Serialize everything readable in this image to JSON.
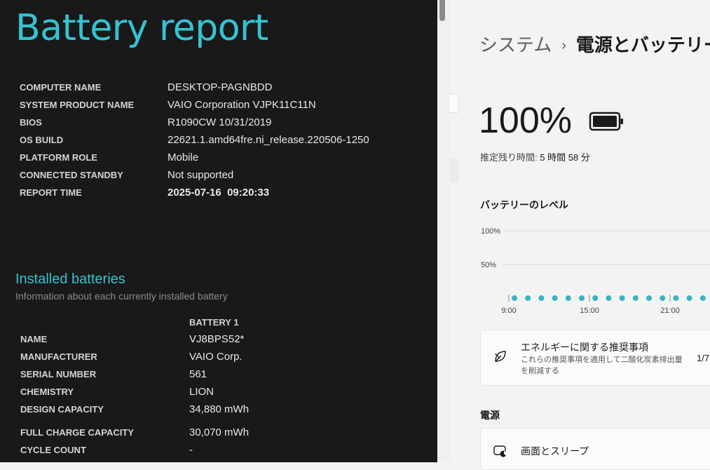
{
  "report": {
    "title": "Battery report",
    "system_info": [
      {
        "label": "COMPUTER NAME",
        "value": "DESKTOP-PAGNBDD"
      },
      {
        "label": "SYSTEM PRODUCT NAME",
        "value": "VAIO Corporation VJPK11C11N"
      },
      {
        "label": "BIOS",
        "value": "R1090CW 10/31/2019"
      },
      {
        "label": "OS BUILD",
        "value": "22621.1.amd64fre.ni_release.220506-1250"
      },
      {
        "label": "PLATFORM ROLE",
        "value": "Mobile"
      },
      {
        "label": "CONNECTED STANDBY",
        "value": "Not supported"
      },
      {
        "label": "REPORT TIME",
        "value": "2025-07-16  09:20:33"
      }
    ],
    "installed": {
      "heading": "Installed batteries",
      "description": "Information about each currently installed battery",
      "column_header": "BATTERY 1",
      "rows": [
        {
          "label": "NAME",
          "value": "VJ8BPS52*"
        },
        {
          "label": "MANUFACTURER",
          "value": "VAIO Corp."
        },
        {
          "label": "SERIAL NUMBER",
          "value": "561"
        },
        {
          "label": "CHEMISTRY",
          "value": "LION"
        },
        {
          "label": "DESIGN CAPACITY",
          "value": "34,880 mWh"
        },
        {
          "label": "FULL CHARGE CAPACITY",
          "value": "30,070 mWh"
        },
        {
          "label": "CYCLE COUNT",
          "value": "-"
        }
      ]
    }
  },
  "settings": {
    "breadcrumb": {
      "parent": "システム",
      "separator": "›",
      "current": "電源とバッテリー"
    },
    "battery_percent": "100%",
    "battery_level_fraction": 1.0,
    "remaining_label": "推定残り時間:",
    "remaining_value": "5 時間 58 分",
    "level_section_title": "バッテリーのレベル",
    "energy_card": {
      "title": "エネルギーに関する推奨事項",
      "description": "これらの推奨事項を適用して二酸化炭素排出量を削減する",
      "count": "1/7"
    },
    "power_section_title": "電源",
    "screen_sleep_label": "画面とスリープ",
    "accent_color": "#3ab4c0"
  },
  "chart_data": {
    "type": "scatter",
    "title": "バッテリーのレベル",
    "yticks": [
      "100%",
      "50%"
    ],
    "ylim": [
      0,
      100
    ],
    "xticks": [
      "9:00",
      "15:00",
      "21:00"
    ],
    "x": [
      9,
      10,
      11,
      12,
      13,
      14,
      15,
      16,
      17,
      18,
      19,
      20,
      21,
      22,
      23
    ],
    "values": [
      0,
      0,
      0,
      0,
      0,
      0,
      0,
      0,
      0,
      0,
      0,
      0,
      0,
      0,
      0
    ],
    "xrange": [
      9,
      24
    ],
    "grid": true
  }
}
